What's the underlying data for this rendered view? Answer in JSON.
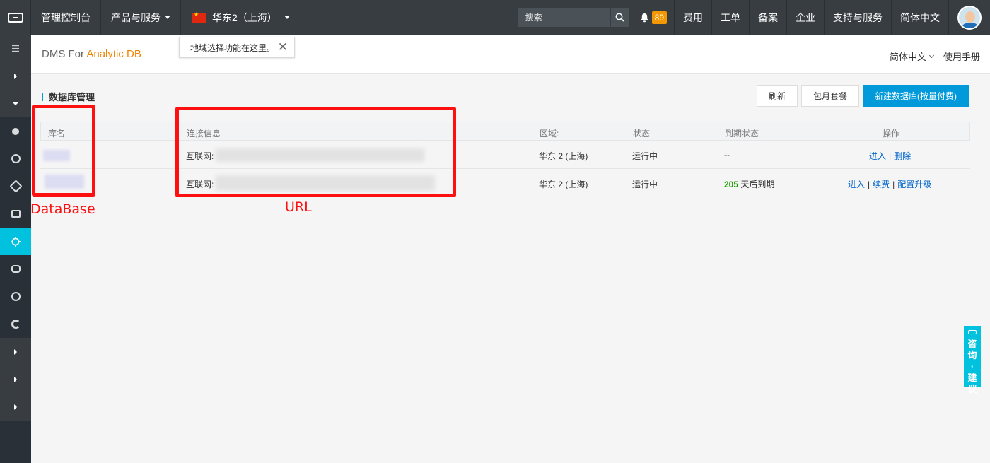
{
  "topbar": {
    "console": "管理控制台",
    "products": "产品与服务",
    "region": "华东2（上海）",
    "search_placeholder": "搜索",
    "notification_count": "89",
    "links": [
      "费用",
      "工单",
      "备案",
      "企业",
      "支持与服务",
      "简体中文"
    ]
  },
  "tooltip": {
    "text": "地域选择功能在这里。",
    "close": "✕"
  },
  "header": {
    "brand_prefix": "DMS For ",
    "brand_accent": "Analytic DB",
    "language": "简体中文",
    "manual": "使用手册"
  },
  "section": {
    "title": "数据库管理",
    "buttons": {
      "refresh": "刷新",
      "monthly": "包月套餐",
      "create": "新建数据库(按量付费)"
    }
  },
  "table": {
    "columns": [
      "库名",
      "连接信息",
      "区域:",
      "状态",
      "到期状态",
      "操作"
    ],
    "rows": [
      {
        "connection_prefix": "互联网:",
        "region": "华东 2 (上海)",
        "status": "运行中",
        "expiry": "--",
        "expiry_days": "",
        "expiry_suffix": "",
        "actions": [
          "进入",
          "删除"
        ]
      },
      {
        "connection_prefix": "互联网:",
        "region": "华东 2 (上海)",
        "status": "运行中",
        "expiry": "",
        "expiry_days": "205",
        "expiry_suffix": "天后到期",
        "actions": [
          "进入",
          "续费",
          "配置升级"
        ]
      }
    ]
  },
  "annotations": {
    "database_label": "DataBase",
    "url_label": "URL",
    "color": "#ff1010"
  },
  "consult_tab": {
    "line1": "咨",
    "line2": "询",
    "dot": "·",
    "line3": "建",
    "line4": "议"
  },
  "colors": {
    "topbar": "#373d41",
    "sidebar": "#293038",
    "sidebar_active": "#00c1de",
    "primary_button": "#0099d9",
    "brand_accent": "#f08300",
    "badge": "#f39800"
  }
}
